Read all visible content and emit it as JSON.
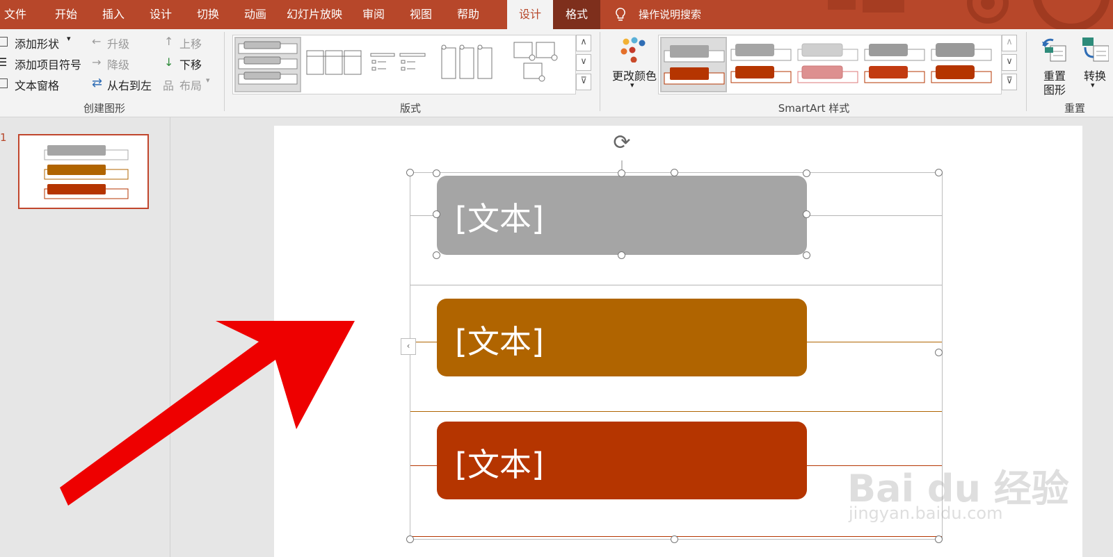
{
  "tabs": [
    {
      "label": "文件"
    },
    {
      "label": "开始"
    },
    {
      "label": "插入"
    },
    {
      "label": "设计"
    },
    {
      "label": "切换"
    },
    {
      "label": "动画"
    },
    {
      "label": "幻灯片放映"
    },
    {
      "label": "审阅"
    },
    {
      "label": "视图"
    },
    {
      "label": "帮助"
    },
    {
      "label": "设计"
    },
    {
      "label": "格式"
    }
  ],
  "search": {
    "label": "操作说明搜索"
  },
  "create_group": {
    "add_shape": "添加形状",
    "add_bullet": "添加项目符号",
    "text_pane": "文本窗格",
    "promote": "升级",
    "demote": "降级",
    "rtl": "从右到左",
    "move_up": "上移",
    "move_down": "下移",
    "layout": "布局",
    "label": "创建图形"
  },
  "layouts_group": {
    "label": "版式"
  },
  "styles_group": {
    "change_colors": "更改颜色",
    "label": "SmartArt 样式"
  },
  "reset_group": {
    "reset_graphic_1": "重置",
    "reset_graphic_2": "图形",
    "convert": "转换",
    "label": "重置"
  },
  "slide_thumb": {
    "number": "1"
  },
  "smartart": {
    "items": [
      {
        "text": "[文本]",
        "color": "#a5a5a5"
      },
      {
        "text": "[文本]",
        "color": "#b06400"
      },
      {
        "text": "[文本]",
        "color": "#b53500"
      }
    ]
  },
  "watermark": {
    "brand": "Bai du 经验",
    "url": "jingyan.baidu.com"
  },
  "colors": {
    "accent": "#b7472a",
    "arrow": "#ee0000"
  }
}
